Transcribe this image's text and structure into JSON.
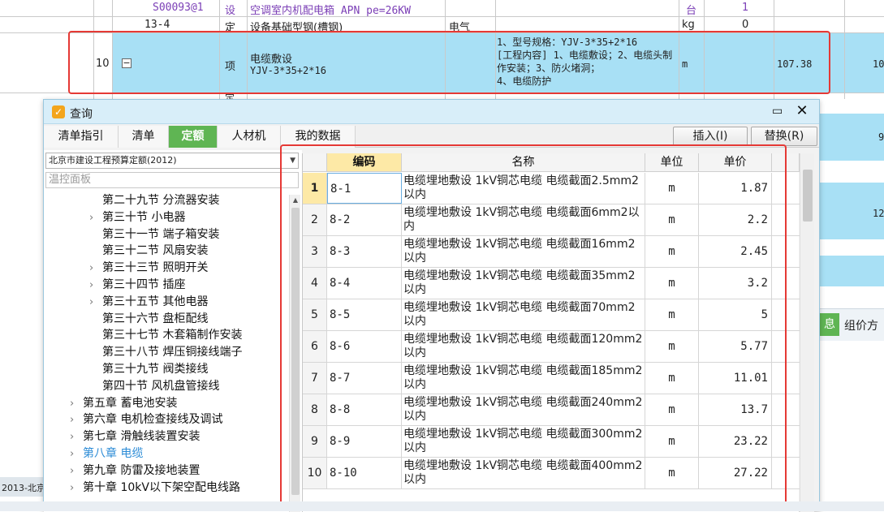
{
  "background": {
    "rows": [
      {
        "code": "S00093@1",
        "type": "设",
        "name": "空调室内机配电箱 APN  pe=26KW",
        "unit": "台",
        "qty": "1"
      },
      {
        "code": "13-4",
        "type": "定",
        "name": "设备基础型钢(槽钢)",
        "category": "电气",
        "unit": "kg",
        "qty": "0"
      }
    ],
    "highlighted": {
      "num": "10",
      "collapse": "−",
      "type": "项",
      "name": "电缆敷设",
      "spec": "YJV-3*35+2*16",
      "features": "1、型号规格：YJV-3*35+2*16\n[工程内容] 1、电缆敷设；2、电缆头制作安装；3、防火堵洞；\n4、电缆防护",
      "unit": "m",
      "qty": "107.38",
      "extra": "10"
    },
    "partial_below": "定",
    "right_values": [
      "9",
      "12"
    ],
    "right_tabs": [
      "息",
      "组价方"
    ],
    "left_fragment": "2013-北京"
  },
  "dialog": {
    "title": "查询",
    "tabs": [
      {
        "label": "清单指引",
        "active": false
      },
      {
        "label": "清单",
        "active": false
      },
      {
        "label": "定额",
        "active": true
      },
      {
        "label": "人材机",
        "active": false
      },
      {
        "label": "我的数据",
        "active": false
      }
    ],
    "insert_label": "插入(I)",
    "replace_label": "替换(R)",
    "library": "北京市建设工程预算定额(2012)",
    "filter_value": "温控面板",
    "tree": [
      {
        "label": "第二十九节  分流器安装",
        "level": 2,
        "arrow": false
      },
      {
        "label": "第三十节  小电器",
        "level": 2,
        "arrow": true
      },
      {
        "label": "第三十一节  端子箱安装",
        "level": 2,
        "arrow": false
      },
      {
        "label": "第三十二节  风扇安装",
        "level": 2,
        "arrow": false
      },
      {
        "label": "第三十三节  照明开关",
        "level": 2,
        "arrow": true
      },
      {
        "label": "第三十四节  插座",
        "level": 2,
        "arrow": true
      },
      {
        "label": "第三十五节  其他电器",
        "level": 2,
        "arrow": true
      },
      {
        "label": "第三十六节  盘柜配线",
        "level": 2,
        "arrow": false
      },
      {
        "label": "第三十七节  木套箱制作安装",
        "level": 2,
        "arrow": false
      },
      {
        "label": "第三十八节  焊压铜接线端子",
        "level": 2,
        "arrow": false
      },
      {
        "label": "第三十九节  阀类接线",
        "level": 2,
        "arrow": false
      },
      {
        "label": "第四十节  风机盘管接线",
        "level": 2,
        "arrow": false
      },
      {
        "label": "第五章  蓄电池安装",
        "level": 1,
        "arrow": true
      },
      {
        "label": "第六章  电机检查接线及调试",
        "level": 1,
        "arrow": true
      },
      {
        "label": "第七章  滑触线装置安装",
        "level": 1,
        "arrow": true
      },
      {
        "label": "第八章  电缆",
        "level": 1,
        "arrow": true,
        "selected": true
      },
      {
        "label": "第九章  防雷及接地装置",
        "level": 1,
        "arrow": true
      },
      {
        "label": "第十章  10kV以下架空配电线路",
        "level": 1,
        "arrow": true
      }
    ],
    "grid": {
      "headers": [
        "编码",
        "名称",
        "单位",
        "单价"
      ],
      "rows": [
        {
          "num": "1",
          "code": "8-1",
          "name": "电缆埋地敷设 1kV铜芯电缆 电缆截面2.5mm2以内",
          "unit": "m",
          "price": "1.87"
        },
        {
          "num": "2",
          "code": "8-2",
          "name": "电缆埋地敷设 1kV铜芯电缆 电缆截面6mm2以内",
          "unit": "m",
          "price": "2.2"
        },
        {
          "num": "3",
          "code": "8-3",
          "name": "电缆埋地敷设 1kV铜芯电缆 电缆截面16mm2以内",
          "unit": "m",
          "price": "2.45"
        },
        {
          "num": "4",
          "code": "8-4",
          "name": "电缆埋地敷设 1kV铜芯电缆 电缆截面35mm2以内",
          "unit": "m",
          "price": "3.2"
        },
        {
          "num": "5",
          "code": "8-5",
          "name": "电缆埋地敷设 1kV铜芯电缆 电缆截面70mm2以内",
          "unit": "m",
          "price": "5"
        },
        {
          "num": "6",
          "code": "8-6",
          "name": "电缆埋地敷设 1kV铜芯电缆 电缆截面120mm2以内",
          "unit": "m",
          "price": "5.77"
        },
        {
          "num": "7",
          "code": "8-7",
          "name": "电缆埋地敷设 1kV铜芯电缆 电缆截面185mm2以内",
          "unit": "m",
          "price": "11.01"
        },
        {
          "num": "8",
          "code": "8-8",
          "name": "电缆埋地敷设 1kV铜芯电缆 电缆截面240mm2以内",
          "unit": "m",
          "price": "13.7"
        },
        {
          "num": "9",
          "code": "8-9",
          "name": "电缆埋地敷设 1kV铜芯电缆 电缆截面300mm2以内",
          "unit": "m",
          "price": "23.22"
        },
        {
          "num": "10",
          "code": "8-10",
          "name": "电缆埋地敷设 1kV铜芯电缆 电缆截面400mm2以内",
          "unit": "m",
          "price": "27.22"
        }
      ]
    }
  },
  "colors": {
    "accent": "#5fb553",
    "highlight_row": "#a8e0f5",
    "annotation": "#e53935",
    "selected_tree": "#2b8bd6"
  }
}
